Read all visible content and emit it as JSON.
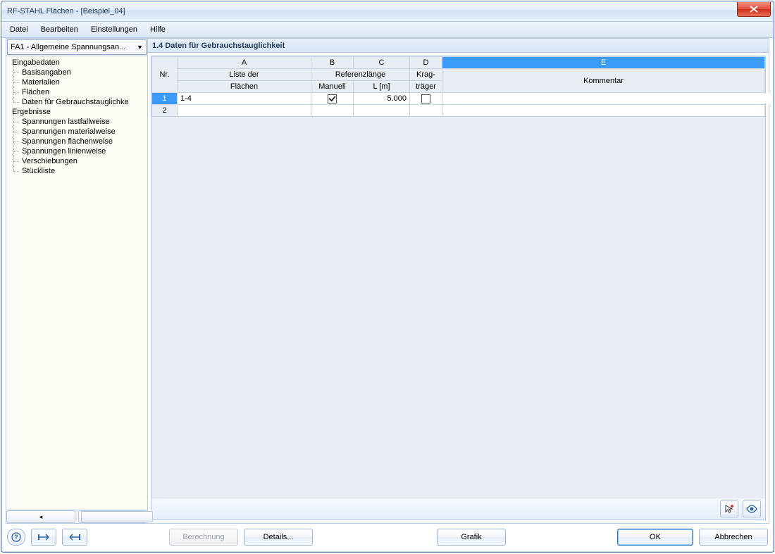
{
  "window": {
    "title": "RF-STAHL Flächen - [Beispiel_04]"
  },
  "menu": {
    "items": [
      "Datei",
      "Bearbeiten",
      "Einstellungen",
      "Hilfe"
    ]
  },
  "nav": {
    "fa_selection": "FA1 - Allgemeine Spannungsan...",
    "groups": [
      {
        "label": "Eingabedaten",
        "children": [
          "Basisangaben",
          "Materialien",
          "Flächen",
          "Daten für Gebrauchstauglichke"
        ]
      },
      {
        "label": "Ergebnisse",
        "children": [
          "Spannungen lastfallweise",
          "Spannungen materialweise",
          "Spannungen flächenweise",
          "Spannungen linienweise",
          "Verschiebungen",
          "Stückliste"
        ]
      }
    ]
  },
  "panel": {
    "title": "1.4 Daten für Gebrauchstauglichkeit",
    "columns": {
      "letters": [
        "A",
        "B",
        "C",
        "D",
        "E"
      ],
      "nr": "Nr.",
      "a1": "Liste der",
      "a2": "Flächen",
      "bc1": "Referenzlänge",
      "b2": "Manuell",
      "c2": "L [m]",
      "d1": "Krag-",
      "d2": "träger",
      "e2": "Kommentar"
    },
    "rows": [
      {
        "nr": "1",
        "flaechen": "1-4",
        "manuell": true,
        "l": "5.000",
        "krag": false,
        "kommentar": ""
      },
      {
        "nr": "2",
        "flaechen": "",
        "manuell": null,
        "l": "",
        "krag": null,
        "kommentar": ""
      }
    ]
  },
  "footer": {
    "berechnung": "Berechnung",
    "details": "Details...",
    "grafik": "Grafik",
    "ok": "OK",
    "abbrechen": "Abbrechen"
  },
  "icons": {
    "help": "?",
    "pick": "pick",
    "view": "eye"
  }
}
